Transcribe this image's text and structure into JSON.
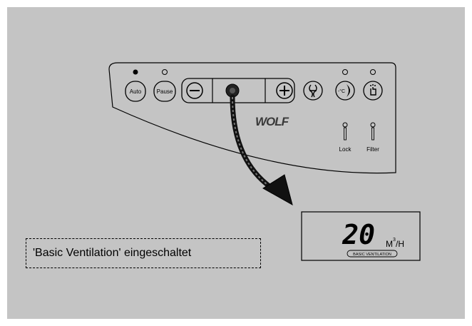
{
  "panel": {
    "brand": "WOLF",
    "buttons": {
      "auto": "Auto",
      "pause": "Pause",
      "minus": "−",
      "plus": "+"
    },
    "indicators": {
      "lock": "Lock",
      "filter": "Filter"
    }
  },
  "display": {
    "value": "20",
    "unit_main": "M",
    "unit_sup": "3",
    "unit_tail": "/H",
    "mode_label": "BASIC VENTILATION"
  },
  "caption": "'Basic Ventilation' eingeschaltet",
  "colors": {
    "background": "#c4c4c4",
    "panel_face": "#c4c4c4",
    "stroke": "#000000",
    "led_on": "#000000"
  },
  "icons": [
    "fan-mode-icon",
    "night-mode-icon",
    "hand-mode-icon",
    "knob-icon",
    "arrow-icon"
  ]
}
